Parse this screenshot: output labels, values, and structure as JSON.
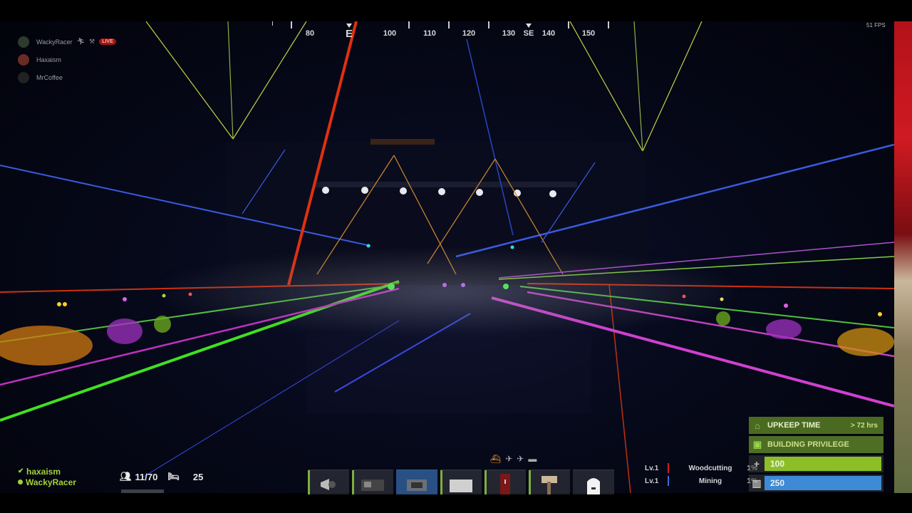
{
  "compass": {
    "labels": [
      {
        "text": "80",
        "cardinal": false
      },
      {
        "text": "E",
        "cardinal": true
      },
      {
        "text": "100",
        "cardinal": false
      },
      {
        "text": "110",
        "cardinal": false
      },
      {
        "text": "120",
        "cardinal": false
      },
      {
        "text": "130",
        "cardinal": false
      },
      {
        "text": "SE",
        "cardinal": false
      },
      {
        "text": "140",
        "cardinal": false
      },
      {
        "text": "150",
        "cardinal": false
      }
    ]
  },
  "fps": "51 FPS",
  "team": {
    "members": [
      {
        "name": "WackyRacer",
        "live_badge": "LIVE"
      },
      {
        "name": "Haxaism"
      },
      {
        "name": "MrCoffee"
      }
    ]
  },
  "online_list": {
    "player1": "haxaism",
    "player2": "WackyRacer"
  },
  "server_stats": {
    "population": "11/70",
    "sleepers": "25"
  },
  "hotbar": {
    "slot_icons": [
      "megaphone-icon",
      "mixing-table-icon",
      "furnace-icon",
      "box-icon",
      "locker-icon",
      "hammer-icon",
      "backpack-icon"
    ],
    "active_slot": 3
  },
  "skills": [
    {
      "level": "Lv.1",
      "name": "Woodcutting",
      "percent": "1%",
      "color": "#cc2222"
    },
    {
      "level": "Lv.1",
      "name": "Mining",
      "percent": "1%",
      "color": "#3a6ed8"
    }
  ],
  "status_panel": {
    "upkeep_label": "UPKEEP TIME",
    "upkeep_value": "> 72 hrs",
    "privilege_label": "BUILDING PRIVILEGE",
    "health_value": "100",
    "health_fraction": 1.0,
    "water_value": "250",
    "water_fraction": 1.0
  },
  "colors": {
    "health": "#8cbf26",
    "water": "#3d8ad6",
    "accent_green": "#a3d13a"
  }
}
